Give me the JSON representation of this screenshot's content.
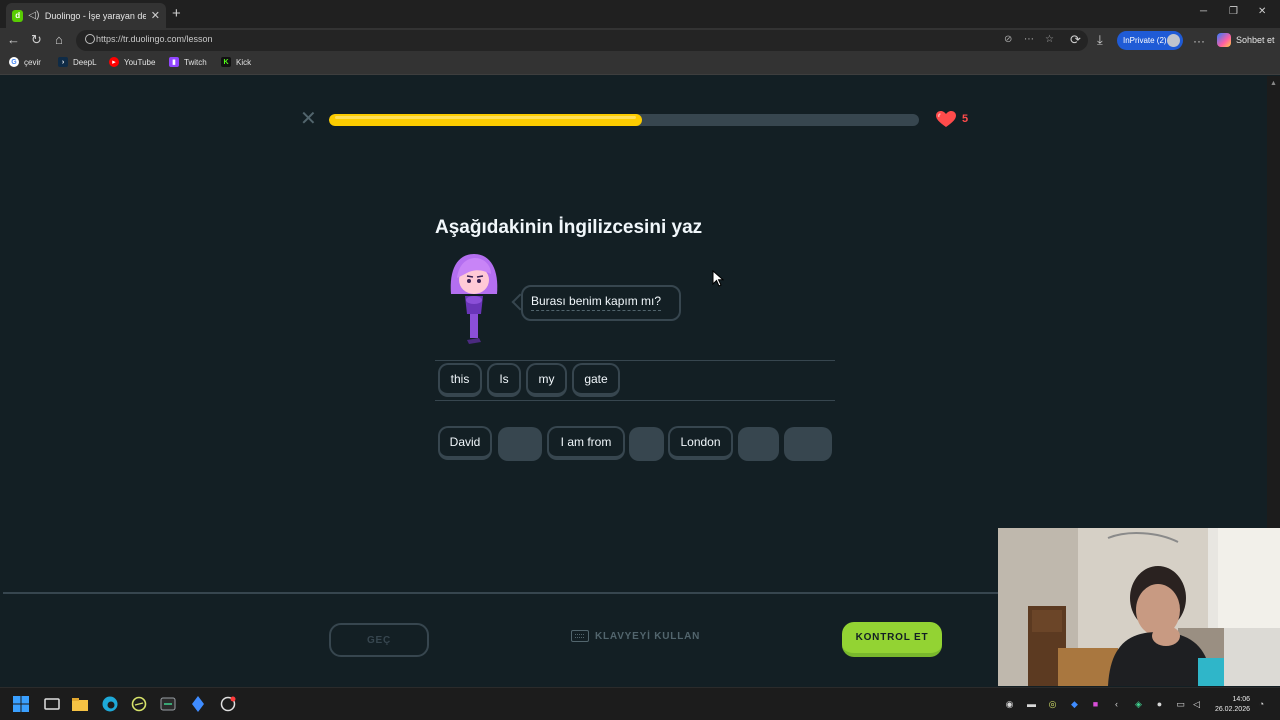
{
  "browser": {
    "tab_title": "Duolingo - İşe yarayan dersler",
    "url": "https://tr.duolingo.com/lesson",
    "inprivate_label": "InPrivate (2)",
    "copilot_label": "Sohbet et",
    "favorites": [
      {
        "label": "çevir",
        "icon": "google-translate-icon",
        "color": "#ffffff"
      },
      {
        "label": "DeepL",
        "icon": "deepl-icon",
        "color": "#0f2b46"
      },
      {
        "label": "YouTube",
        "icon": "youtube-icon",
        "color": "#ff0000"
      },
      {
        "label": "Twitch",
        "icon": "twitch-icon",
        "color": "#9146ff"
      },
      {
        "label": "Kick",
        "icon": "kick-icon",
        "color": "#53fc18"
      }
    ]
  },
  "lesson": {
    "progress_fraction": 0.53,
    "hearts": "5",
    "instruction": "Aşağıdakinin İngilizcesini yaz",
    "prompt_sentence": "Burası benim kapım mı?",
    "answer_words": [
      "this",
      "Is",
      "my",
      "gate"
    ],
    "word_bank": [
      {
        "label": "David",
        "used": false
      },
      {
        "label": "",
        "used": true
      },
      {
        "label": "I am from",
        "used": false
      },
      {
        "label": "",
        "used": true
      },
      {
        "label": "London",
        "used": false
      },
      {
        "label": "",
        "used": true
      },
      {
        "label": "",
        "used": true
      }
    ],
    "skip_label": "GEÇ",
    "keyboard_label": "KLAVYEYİ KULLAN",
    "check_label": "KONTROL ET"
  },
  "colors": {
    "background": "#131f24",
    "border": "#37464f",
    "progress": "#fccc00",
    "heart": "#ff4b4b",
    "check_button": "#93d333",
    "character": "#9b59e0"
  },
  "taskbar": {
    "time": "14:06",
    "date": "26.02.2026"
  }
}
